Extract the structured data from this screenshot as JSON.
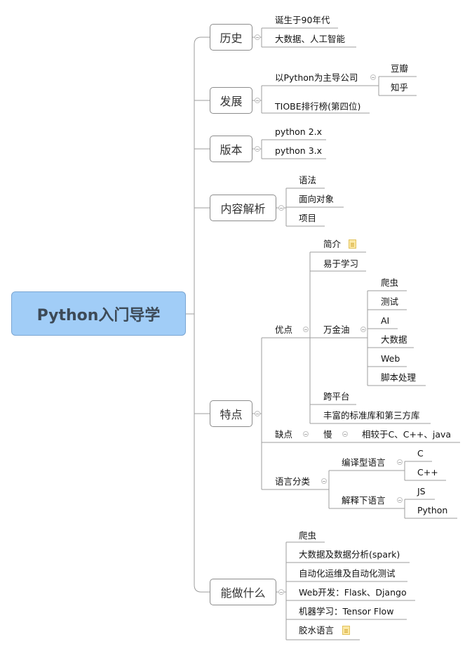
{
  "root": "Python入门导学",
  "history": {
    "title": "历史",
    "items": [
      "诞生于90年代",
      "大数据、人工智能"
    ]
  },
  "development": {
    "title": "发展",
    "lead": "以Python为主导公司",
    "companies": [
      "豆瓣",
      "知乎"
    ],
    "tiobe": "TIOBE排行榜(第四位)"
  },
  "version": {
    "title": "版本",
    "items": [
      "python 2.x",
      "python 3.x"
    ]
  },
  "content": {
    "title": "内容解析",
    "items": [
      "语法",
      "面向对象",
      "项目"
    ]
  },
  "features": {
    "title": "特点",
    "pros": {
      "label": "优点",
      "intro": "简介",
      "easy": "易于学习",
      "versatile": {
        "label": "万金油",
        "items": [
          "爬虫",
          "测试",
          "AI",
          "大数据",
          "Web",
          "脚本处理"
        ]
      },
      "cross": "跨平台",
      "libs": "丰富的标准库和第三方库"
    },
    "cons": {
      "label": "缺点",
      "slow": "慢",
      "compare": "相较于C、C++、java"
    },
    "lang": {
      "label": "语言分类",
      "compiled": {
        "label": "编译型语言",
        "items": [
          "C",
          "C++"
        ]
      },
      "interp": {
        "label": "解释下语言",
        "items": [
          "JS",
          "Python"
        ]
      }
    }
  },
  "uses": {
    "title": "能做什么",
    "items": [
      "爬虫",
      "大数据及数据分析(spark)",
      "自动化运维及自动化测试",
      "Web开发：Flask、Django",
      "机器学习：Tensor Flow",
      "胶水语言"
    ]
  },
  "colors": {
    "root_fill": "#a1cdf7",
    "line": "#9e9e9e",
    "note": "#fbe8a6"
  },
  "icons": [
    "collapse-icon",
    "note-icon"
  ]
}
